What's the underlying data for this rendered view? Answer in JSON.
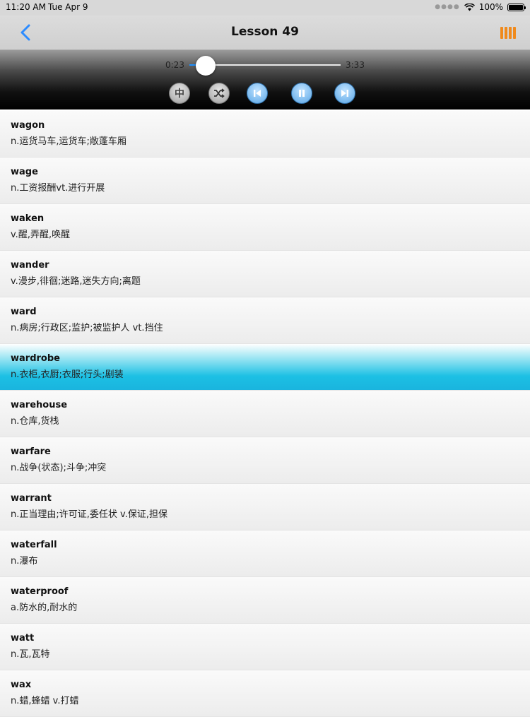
{
  "status_bar": {
    "time": "11:20 AM",
    "date": "Tue Apr 9",
    "battery": "100%"
  },
  "nav": {
    "title": "Lesson 49",
    "back_icon": "chevron-left-icon",
    "menu_icon": "vertical-bars-icon",
    "accent": "#f08a1c"
  },
  "player": {
    "current_time": "0:23",
    "total_time": "3:33",
    "progress": 0.108,
    "lang_button": "中",
    "buttons": [
      "chinese-toggle",
      "shuffle",
      "previous",
      "pause",
      "next"
    ]
  },
  "words": [
    {
      "word": "wagon",
      "def": "n.运货马车,运货车;敞蓬车厢"
    },
    {
      "word": "wage",
      "def": "n.工资报酬vt.进行开展"
    },
    {
      "word": "waken",
      "def": "v.醒,弄醒,唤醒"
    },
    {
      "word": "wander",
      "def": "v.漫步,徘徊;迷路,迷失方向;离题"
    },
    {
      "word": "ward",
      "def": "n.病房;行政区;监护;被监护人 vt.挡住"
    },
    {
      "word": "wardrobe",
      "def": "n.衣柜,衣厨;衣服;行头;剧装"
    },
    {
      "word": "warehouse",
      "def": "n.仓库,货栈"
    },
    {
      "word": "warfare",
      "def": "n.战争(状态);斗争;冲突"
    },
    {
      "word": "warrant",
      "def": "n.正当理由;许可证,委任状 v.保证,担保"
    },
    {
      "word": "waterfall",
      "def": "n.瀑布"
    },
    {
      "word": "waterproof",
      "def": "a.防水的,耐水的"
    },
    {
      "word": "watt",
      "def": "n.瓦,瓦特"
    },
    {
      "word": "wax",
      "def": "n.蜡,蜂蜡 v.打蜡"
    }
  ],
  "active_index": 5
}
